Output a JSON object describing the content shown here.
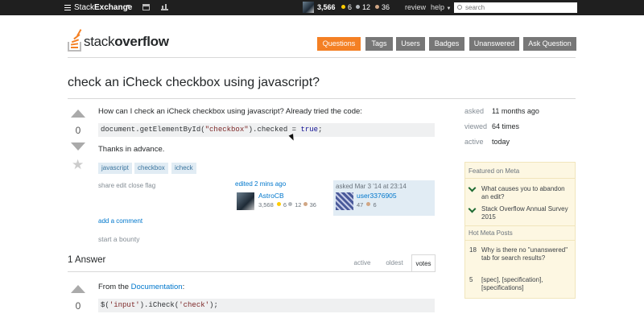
{
  "topbar": {
    "brand_a": "Stack",
    "brand_b": "Exchange",
    "reputation": "3,566",
    "gold": "6",
    "silver": "12",
    "bronze": "36",
    "review": "review",
    "help": "help",
    "search_placeholder": "search",
    "colors": {
      "gold": "#ffcc01",
      "silver": "#b4b8bc",
      "bronze": "#d1a684"
    }
  },
  "logo": {
    "a": "stack",
    "b": "overflow"
  },
  "nav": [
    "Questions",
    "Tags",
    "Users",
    "Badges",
    "Unanswered",
    "Ask Question"
  ],
  "question": {
    "title": "check an iCheck checkbox using javascript?",
    "votes": "0",
    "text1": "How can I check an iCheck checkbox using javascript? Already tried the code:",
    "code_a": "document.getElementById(",
    "code_b": "\"checkbox\"",
    "code_c": ").checked = ",
    "code_d": "true",
    "code_e": ";",
    "text2": "Thanks in advance.",
    "tags": [
      "javascript",
      "checkbox",
      "icheck"
    ],
    "menu": "share  edit  close  flag",
    "edited": {
      "when": "edited 2 mins ago",
      "name": "AstroCB",
      "rep": "3,568",
      "gold": "6",
      "silver": "12",
      "bronze": "36"
    },
    "asked": {
      "when": "asked Mar 3 '14 at 23:14",
      "name": "user3376905",
      "rep": "47",
      "bronze": "6"
    },
    "add_comment": "add a comment",
    "bounty": "start a bounty"
  },
  "answers": {
    "heading": "1 Answer",
    "tabs": [
      "active",
      "oldest",
      "votes"
    ],
    "first": {
      "votes": "0",
      "text_a": "From the ",
      "link": "Documentation",
      "text_b": ":",
      "code_a": "$(",
      "code_b": "'input'",
      "code_c": ").iCheck(",
      "code_d": "'check'",
      "code_e": ");"
    }
  },
  "stats": [
    {
      "label": "asked",
      "value": "11 months ago"
    },
    {
      "label": "viewed",
      "value": "64 times"
    },
    {
      "label": "active",
      "value": "today"
    }
  ],
  "meta": {
    "featured_heading": "Featured on Meta",
    "featured": [
      "What causes you to abandon an edit?",
      "Stack Overflow Annual Survey 2015"
    ],
    "hot_heading": "Hot Meta Posts",
    "hot": [
      {
        "num": "18",
        "title": "Why is there no \"unanswered\" tab for search results?"
      },
      {
        "num": "5",
        "title": "[spec], [specification], [specifications]"
      }
    ]
  }
}
